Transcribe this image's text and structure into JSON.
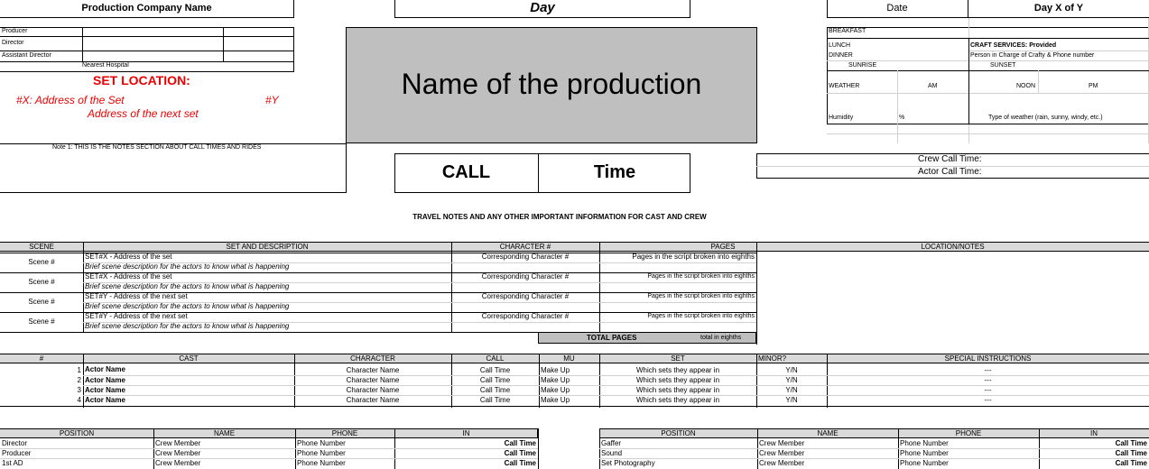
{
  "header": {
    "company_name": "Production Company Name",
    "day": "Day",
    "date_label": "Date",
    "day_x_of_y": "Day X of Y"
  },
  "crew_left": {
    "producer": "Producer",
    "director": "Director",
    "assistant_director": "Assistant Director",
    "nearest_hospital": "Nearest Hospital"
  },
  "set_location": {
    "title": "SET LOCATION:",
    "address": "#X: Address of the Set",
    "y_label": "#Y",
    "next_address": "Address of the next set"
  },
  "production_title": "Name of the production",
  "meals": {
    "breakfast": "BREAKFAST",
    "lunch": "LUNCH",
    "dinner": "DINNER",
    "craft_services": "CRAFT SERVICES: Provided",
    "craft_person": "Person in Charge of Crafty & Phone number",
    "sunrise": "SUNRISE",
    "sunset": "SUNSET"
  },
  "weather": {
    "label": "WEATHER",
    "am": "AM",
    "noon": "NOON",
    "pm": "PM",
    "humidity": "Humidity",
    "percent": "%",
    "type": "Type of weather (rain, sunny, windy, etc.)"
  },
  "notes": {
    "note1": "Note 1: THIS IS THE NOTES SECTION ABOUT CALL TIMES AND RIDES"
  },
  "call": {
    "call_label": "CALL",
    "time_label": "Time",
    "crew_call": "Crew Call Time:",
    "actor_call": "Actor Call Time:"
  },
  "travel_notes": "TRAVEL NOTES AND ANY OTHER IMPORTANT INFORMATION FOR CAST AND CREW",
  "scenes": {
    "headers": [
      "SCENE",
      "SET AND DESCRIPTION",
      "CHARACTER #",
      "PAGES",
      "LOCATION/NOTES"
    ],
    "rows": [
      {
        "scene": "Scene #",
        "set": "SET#X - Address of the set",
        "desc": "Brief scene description for the actors to know what is happening",
        "character": "Corresponding Character #",
        "pages": "Pages in the script broken into eighths"
      },
      {
        "scene": "Scene #",
        "set": "SET#X - Address of the set",
        "desc": "Brief scene description for the actors to know what is happening",
        "character": "Corresponding Character #",
        "pages": "Pages in the script broken into eighths"
      },
      {
        "scene": "Scene #",
        "set": "SET#Y - Address of the next set",
        "desc": "Brief scene description for the actors to know what is happening",
        "character": "Corresponding Character #",
        "pages": "Pages in the script broken into eighths"
      },
      {
        "scene": "Scene #",
        "set": "SET#Y - Address of the next set",
        "desc": "Brief scene description for the actors to know what is happening",
        "character": "Corresponding Character #",
        "pages": "Pages in the script broken into eighths"
      }
    ],
    "total_pages_label": "TOTAL PAGES",
    "total_pages_value": "total in eighths"
  },
  "cast": {
    "headers": [
      "#",
      "CAST",
      "CHARACTER",
      "CALL",
      "MU",
      "SET",
      "MINOR?",
      "SPECIAL INSTRUCTIONS"
    ],
    "rows": [
      {
        "num": "1",
        "name": "Actor Name",
        "character": "Character Name",
        "call": "Call Time",
        "mu": "Make Up",
        "set": "Which sets they appear in",
        "minor": "Y/N",
        "special": "---"
      },
      {
        "num": "2",
        "name": "Actor Name",
        "character": "Character Name",
        "call": "Call Time",
        "mu": "Make Up",
        "set": "Which sets they appear in",
        "minor": "Y/N",
        "special": "---"
      },
      {
        "num": "3",
        "name": "Actor Name",
        "character": "Character Name",
        "call": "Call Time",
        "mu": "Make Up",
        "set": "Which sets they appear in",
        "minor": "Y/N",
        "special": "---"
      },
      {
        "num": "4",
        "name": "Actor Name",
        "character": "Character Name",
        "call": "Call Time",
        "mu": "Make Up",
        "set": "Which sets they appear in",
        "minor": "Y/N",
        "special": "---"
      }
    ]
  },
  "crew_left_table": {
    "headers": [
      "POSITION",
      "NAME",
      "PHONE",
      "IN"
    ],
    "rows": [
      {
        "position": "Director",
        "name": "Crew Member",
        "phone": "Phone Number",
        "in": "Call Time"
      },
      {
        "position": "Producer",
        "name": "Crew Member",
        "phone": "Phone Number",
        "in": "Call Time"
      },
      {
        "position": "1st AD",
        "name": "Crew Member",
        "phone": "Phone Number",
        "in": "Call Time"
      }
    ]
  },
  "crew_right_table": {
    "headers": [
      "POSITION",
      "NAME",
      "PHONE",
      "IN"
    ],
    "rows": [
      {
        "position": "Gaffer",
        "name": "Crew Member",
        "phone": "Phone Number",
        "in": "Call Time"
      },
      {
        "position": "Sound",
        "name": "Crew Member",
        "phone": "Phone Number",
        "in": "Call Time"
      },
      {
        "position": "Set Photography",
        "name": "Crew Member",
        "phone": "Phone Number",
        "in": "Call Time"
      }
    ]
  }
}
